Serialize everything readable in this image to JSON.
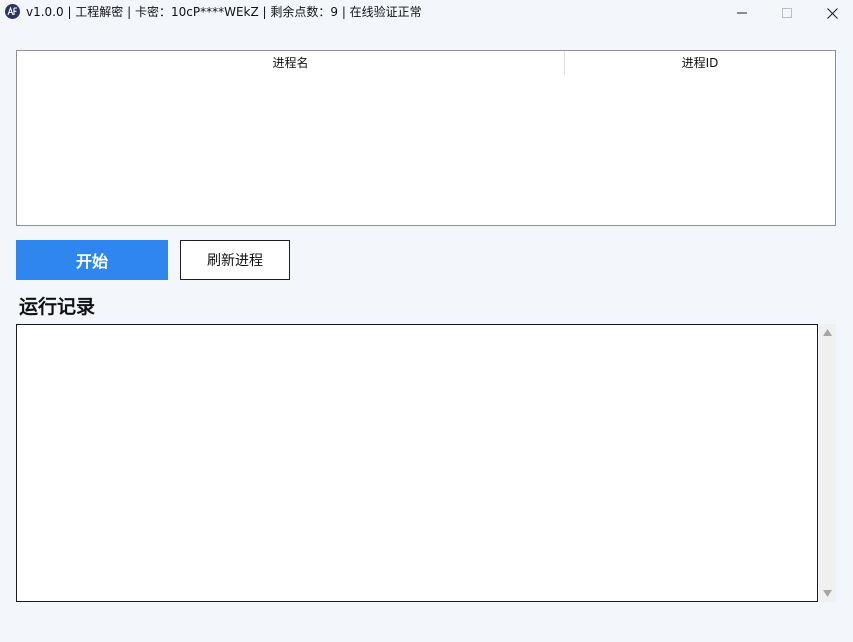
{
  "window": {
    "title": "v1.0.0 | 工程解密 | 卡密：10cP****WEkZ | 剩余点数：9 | 在线验证正常",
    "icon": "app-logo-icon",
    "controls": [
      "minimize-icon",
      "maximize-icon",
      "close-icon"
    ]
  },
  "process_table": {
    "columns": [
      "进程名",
      "进程ID"
    ],
    "rows": []
  },
  "buttons": {
    "start_label": "开始",
    "refresh_label": "刷新进程"
  },
  "log": {
    "title": "运行记录",
    "content": ""
  },
  "colors": {
    "background": "#f3f7fc",
    "accent": "#2f86ee",
    "button_text": "#ffffff"
  }
}
